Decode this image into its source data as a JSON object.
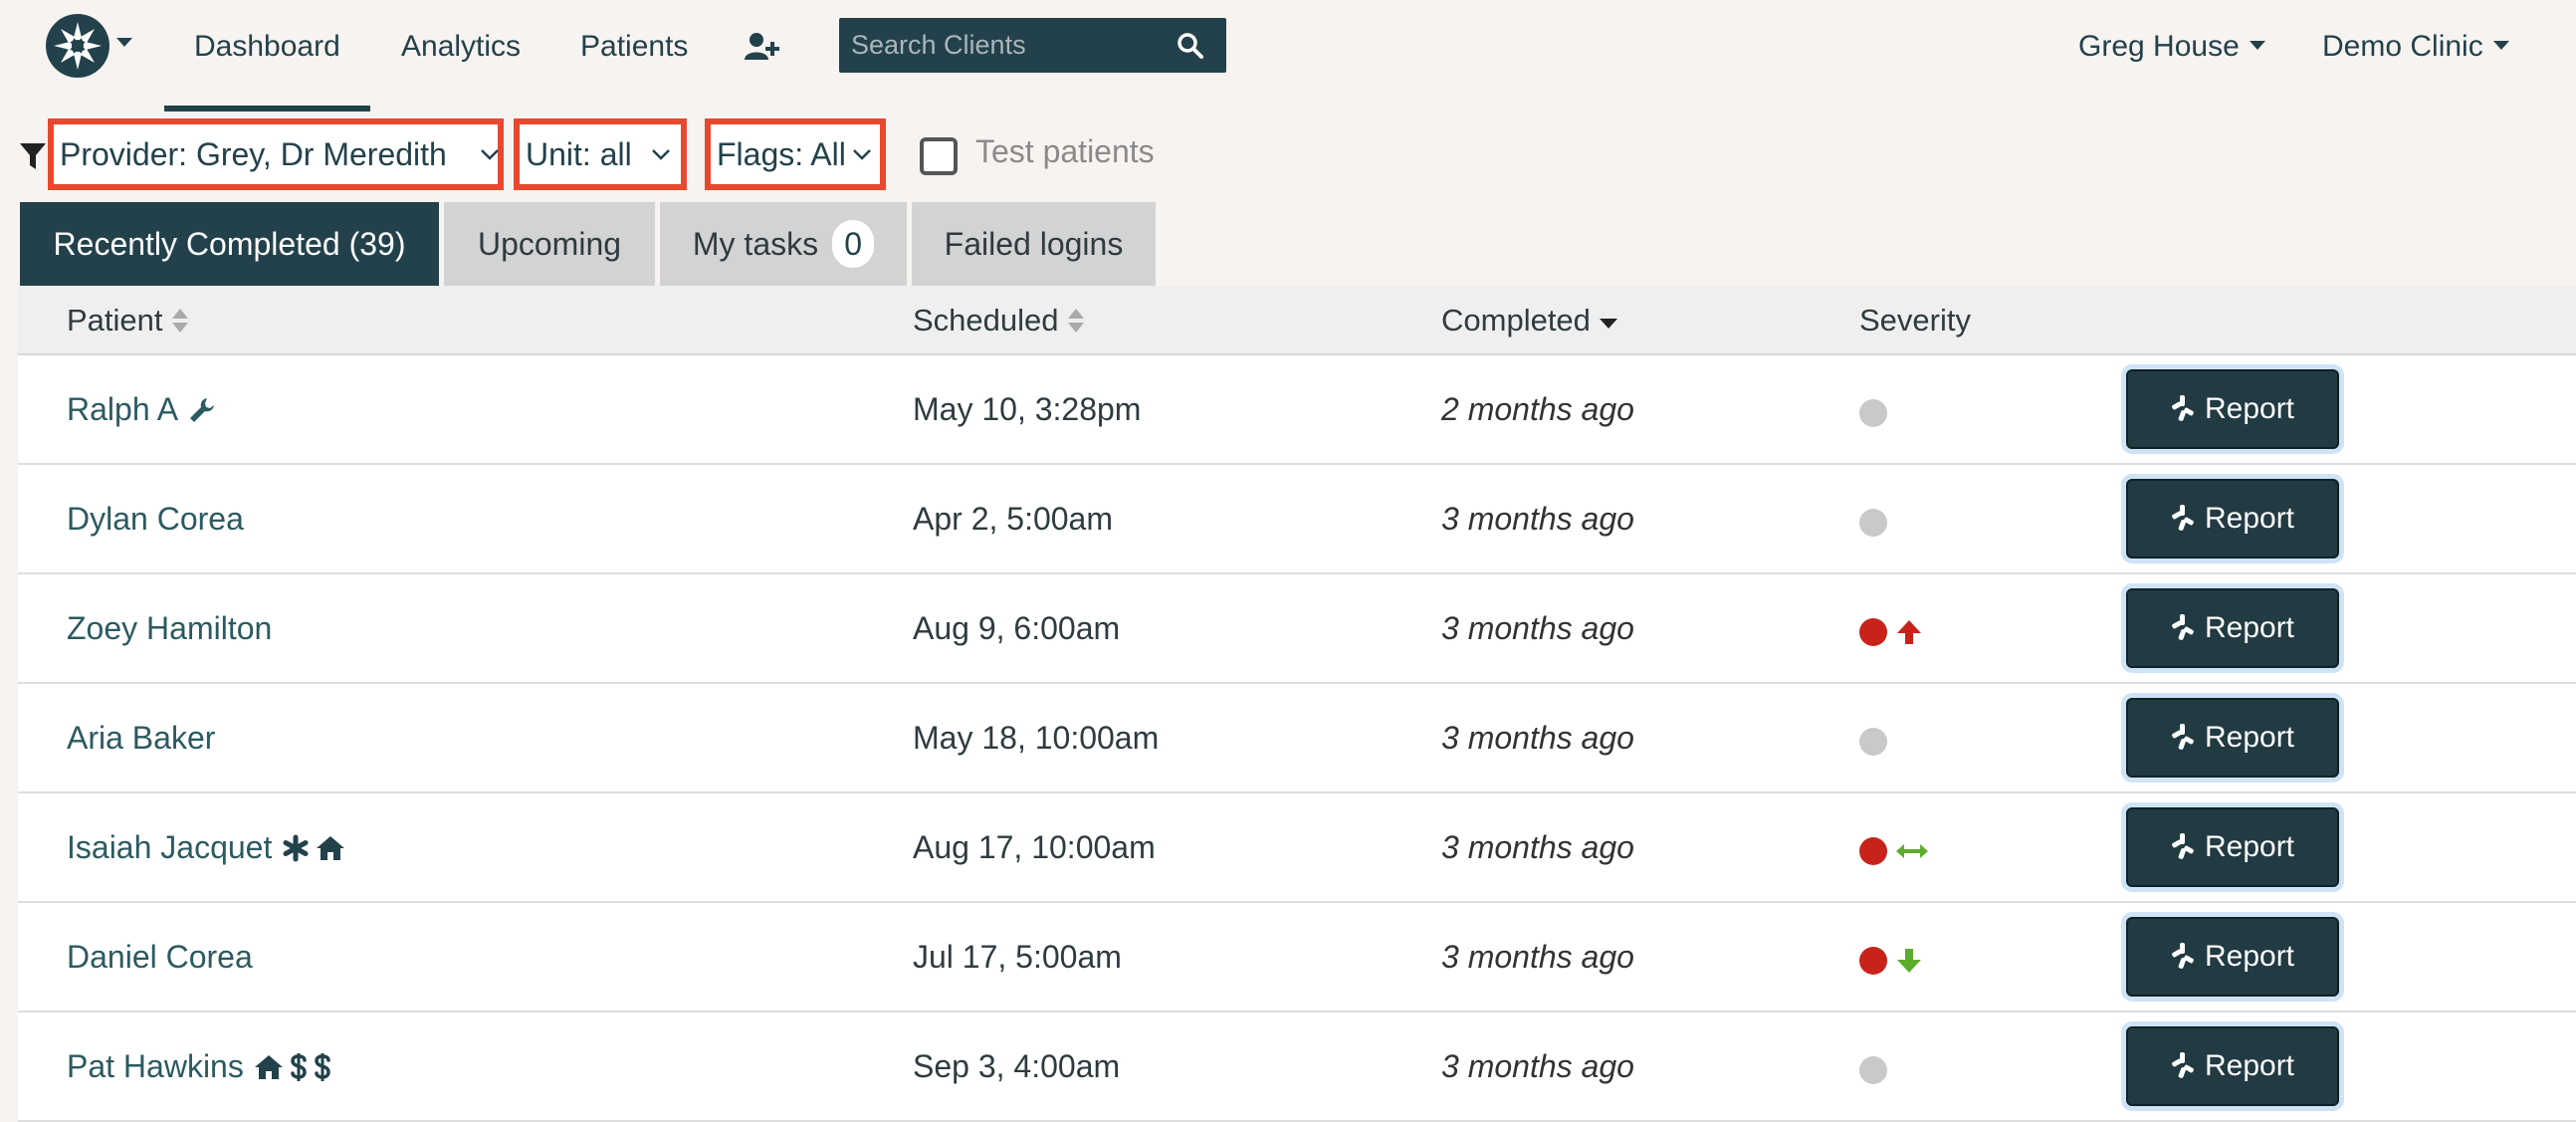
{
  "nav": {
    "tabs": [
      {
        "label": "Dashboard",
        "active": true
      },
      {
        "label": "Analytics",
        "active": false
      },
      {
        "label": "Patients",
        "active": false
      }
    ],
    "search_placeholder": "Search Clients",
    "user_label": "Greg House",
    "clinic_label": "Demo Clinic"
  },
  "filters": {
    "provider": "Provider: Grey, Dr Meredith",
    "unit": "Unit: all",
    "flags": "Flags: All",
    "test_patients": "Test patients",
    "test_patients_checked": false
  },
  "tabs": [
    {
      "label": "Recently Completed (39)",
      "active": true
    },
    {
      "label": "Upcoming",
      "active": false
    },
    {
      "label": "My tasks",
      "count": "0",
      "active": false
    },
    {
      "label": "Failed logins",
      "active": false
    }
  ],
  "table": {
    "columns": [
      "Patient",
      "Scheduled",
      "Completed",
      "Severity"
    ],
    "button_label": "Report",
    "rows": [
      {
        "patient": "Ralph A",
        "flags": [
          "wrench-icon"
        ],
        "scheduled": "May 10, 3:28pm",
        "completed": "2 months ago",
        "severity": "none",
        "trend": "none"
      },
      {
        "patient": "Dylan Corea",
        "flags": [],
        "scheduled": "Apr 2, 5:00am",
        "completed": "3 months ago",
        "severity": "none",
        "trend": "none"
      },
      {
        "patient": "Zoey Hamilton",
        "flags": [],
        "scheduled": "Aug 9, 6:00am",
        "completed": "3 months ago",
        "severity": "high",
        "trend": "up"
      },
      {
        "patient": "Aria Baker",
        "flags": [],
        "scheduled": "May 18, 10:00am",
        "completed": "3 months ago",
        "severity": "none",
        "trend": "none"
      },
      {
        "patient": "Isaiah Jacquet",
        "flags": [
          "asterisk-icon",
          "home-icon"
        ],
        "scheduled": "Aug 17, 10:00am",
        "completed": "3 months ago",
        "severity": "high",
        "trend": "flat"
      },
      {
        "patient": "Daniel Corea",
        "flags": [],
        "scheduled": "Jul 17, 5:00am",
        "completed": "3 months ago",
        "severity": "high",
        "trend": "down"
      },
      {
        "patient": "Pat Hawkins",
        "flags": [
          "home-icon",
          "dollar-icon",
          "dollar-icon"
        ],
        "scheduled": "Sep 3, 4:00am",
        "completed": "3 months ago",
        "severity": "none",
        "trend": "none"
      }
    ]
  },
  "colors": {
    "brand": "#23414a",
    "highlight_border": "#e8482d",
    "severity_high": "#c8231b",
    "severity_none": "#c9c9c9",
    "trend_up": "#c8231b",
    "trend_down": "#5cad2c",
    "trend_flat": "#5cad2c"
  }
}
